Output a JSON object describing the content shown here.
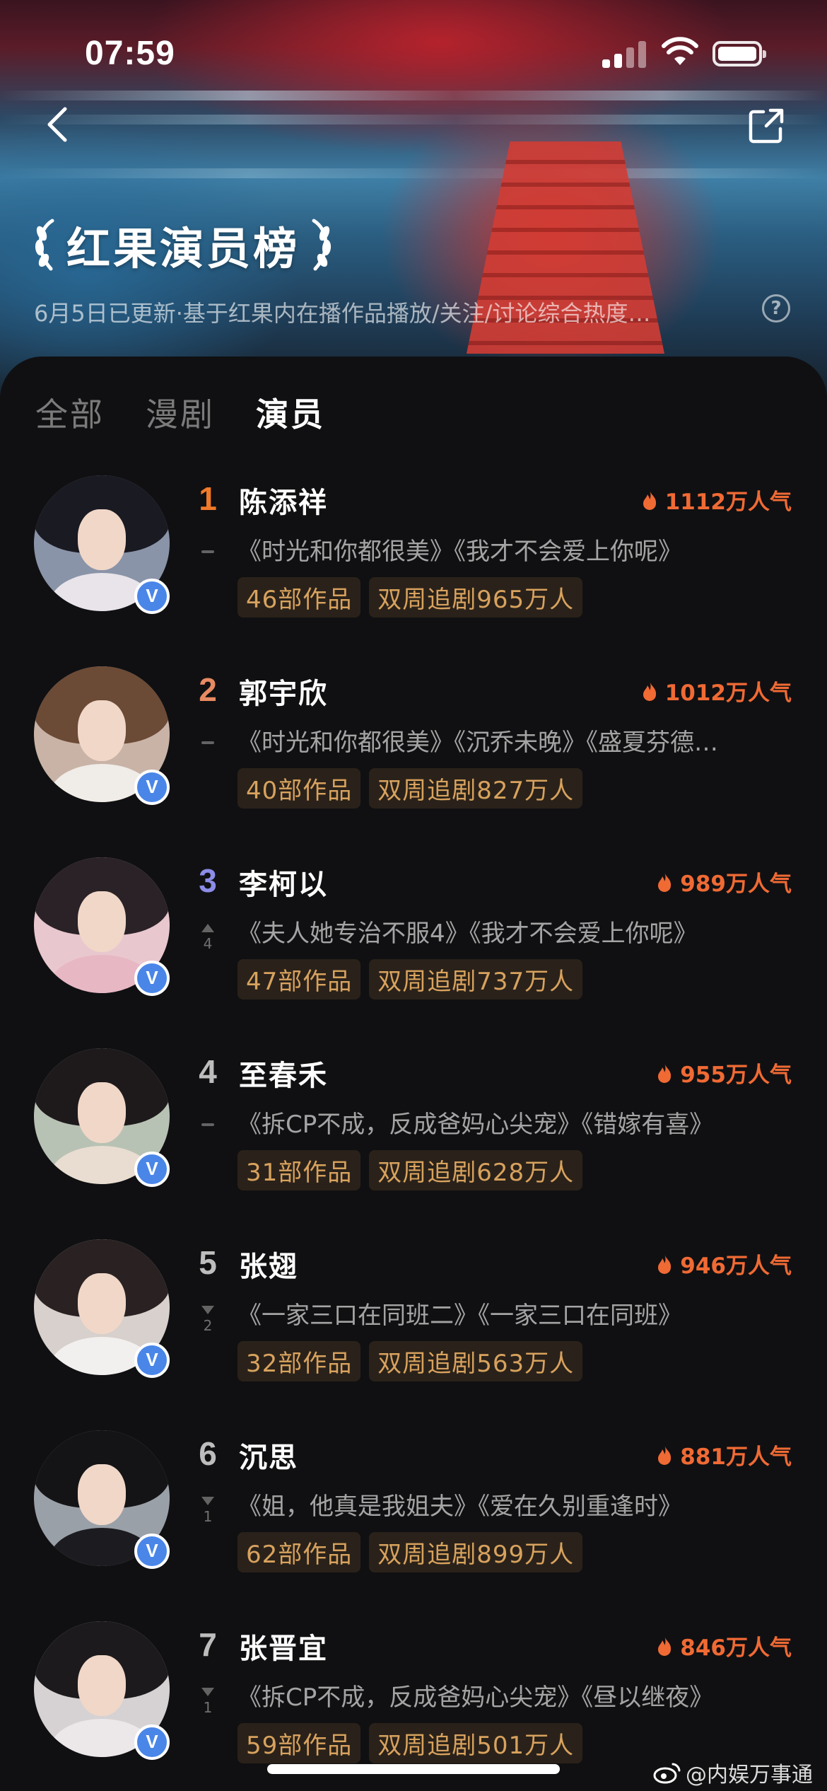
{
  "status": {
    "time": "07:59"
  },
  "header": {
    "title": "红果演员榜",
    "subtitle": "6月5日已更新·基于红果内在播作品播放/关注/讨论综合热度…",
    "help": "?"
  },
  "tabs": [
    {
      "label": "全部",
      "active": false
    },
    {
      "label": "漫剧",
      "active": false
    },
    {
      "label": "演员",
      "active": true
    }
  ],
  "colors": {
    "heat": "#f06a34",
    "tag_text": "#d8a25e",
    "rank1": "#f07a2a",
    "rank2": "#e88a62",
    "rank3": "#8c8ce8",
    "rank_other": "#bdbdbd",
    "verified": "#4a86e8"
  },
  "list": [
    {
      "rank": "1",
      "name": "陈添祥",
      "heat": "1112万人气",
      "works": "《时光和你都很美》《我才不会爱上你呢》",
      "tag1": "46部作品",
      "tag2": "双周追剧965万人",
      "trend": "flat",
      "trend_num": ""
    },
    {
      "rank": "2",
      "name": "郭宇欣",
      "heat": "1012万人气",
      "works": "《时光和你都很美》《沉乔未晚》《盛夏芬德…",
      "tag1": "40部作品",
      "tag2": "双周追剧827万人",
      "trend": "flat",
      "trend_num": ""
    },
    {
      "rank": "3",
      "name": "李柯以",
      "heat": "989万人气",
      "works": "《夫人她专治不服4》《我才不会爱上你呢》",
      "tag1": "47部作品",
      "tag2": "双周追剧737万人",
      "trend": "up",
      "trend_num": "4"
    },
    {
      "rank": "4",
      "name": "至春禾",
      "heat": "955万人气",
      "works": "《拆CP不成，反成爸妈心尖宠》《错嫁有喜》",
      "tag1": "31部作品",
      "tag2": "双周追剧628万人",
      "trend": "flat",
      "trend_num": ""
    },
    {
      "rank": "5",
      "name": "张翅",
      "heat": "946万人气",
      "works": "《一家三口在同班二》《一家三口在同班》",
      "tag1": "32部作品",
      "tag2": "双周追剧563万人",
      "trend": "down",
      "trend_num": "2"
    },
    {
      "rank": "6",
      "name": "沉思",
      "heat": "881万人气",
      "works": "《姐，他真是我姐夫》《爱在久别重逢时》",
      "tag1": "62部作品",
      "tag2": "双周追剧899万人",
      "trend": "down",
      "trend_num": "1"
    },
    {
      "rank": "7",
      "name": "张晋宜",
      "heat": "846万人气",
      "works": "《拆CP不成，反成爸妈心尖宠》《昼以继夜》",
      "tag1": "59部作品",
      "tag2": "双周追剧501万人",
      "trend": "down",
      "trend_num": "1"
    }
  ],
  "watermark": "@内娱万事通"
}
